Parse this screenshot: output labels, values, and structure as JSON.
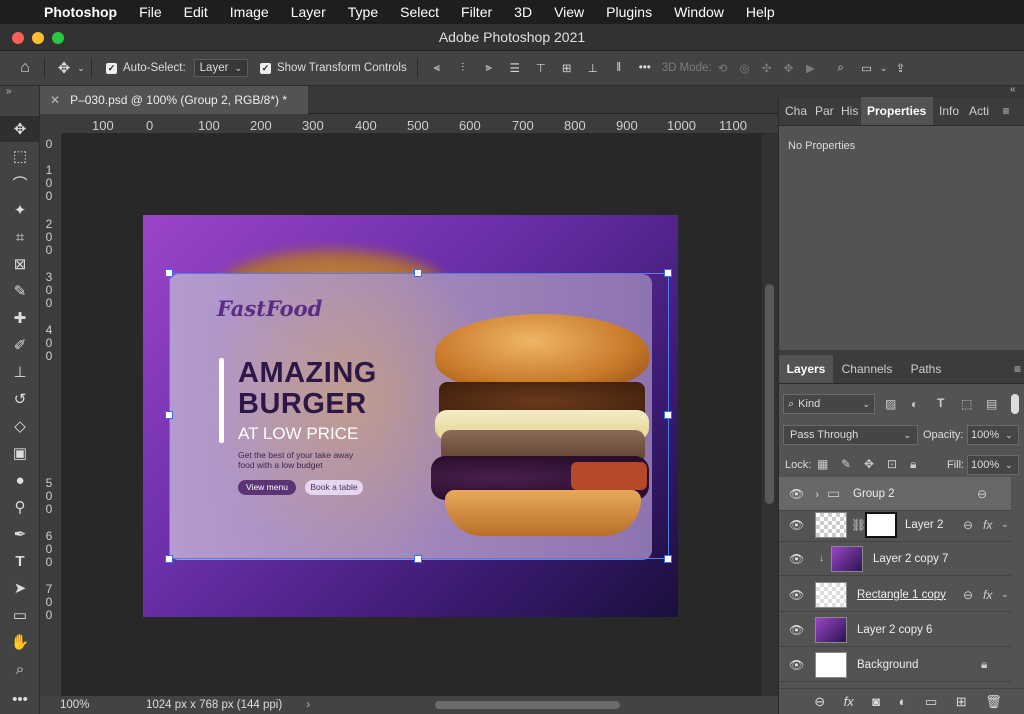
{
  "menubar": {
    "app": "Photoshop",
    "items": [
      "File",
      "Edit",
      "Image",
      "Layer",
      "Type",
      "Select",
      "Filter",
      "3D",
      "View",
      "Plugins",
      "Window",
      "Help"
    ]
  },
  "window": {
    "title": "Adobe Photoshop 2021"
  },
  "options_bar": {
    "auto_select_label": "Auto-Select:",
    "auto_select_value": "Layer",
    "show_transform_label": "Show Transform Controls",
    "more_label": "•••",
    "mode_3d_label": "3D Mode:"
  },
  "document": {
    "tab_title": "P–030.psd @ 100% (Group 2, RGB/8*) *",
    "zoom": "100%",
    "info": "1024 px x 768 px (144 ppi)"
  },
  "rulers": {
    "h": [
      "100",
      "0",
      "100",
      "200",
      "300",
      "400",
      "500",
      "600",
      "700",
      "800",
      "900",
      "1000",
      "1100"
    ],
    "v": [
      [
        "0"
      ],
      [
        "1",
        "0",
        "0"
      ],
      [
        "2",
        "0",
        "0"
      ],
      [
        "3",
        "0",
        "0"
      ],
      [
        "4",
        "0",
        "0"
      ],
      [
        "5",
        "0",
        "0"
      ],
      [
        "6",
        "0",
        "0"
      ],
      [
        "7",
        "0",
        "0"
      ]
    ]
  },
  "artwork": {
    "brand": "FastFood",
    "headline_line1": "AMAZING",
    "headline_line2": "BURGER",
    "subheadline": "AT LOW PRICE",
    "description": "Get the best of your take away food with a low budget",
    "button_primary": "View menu",
    "button_secondary": "Book a table",
    "colors": {
      "bg_start": "#9b45c8",
      "bg_end": "#1b0f3c",
      "accent": "#5b3478"
    }
  },
  "properties_panel": {
    "tabs": [
      "Cha",
      "Par",
      "His",
      "Properties",
      "Info",
      "Acti"
    ],
    "active_tab": "Properties",
    "content": "No Properties"
  },
  "layers_panel": {
    "tabs": [
      "Layers",
      "Channels",
      "Paths"
    ],
    "active_tab": "Layers",
    "filter_label": "Kind",
    "blend_mode": "Pass Through",
    "opacity_label": "Opacity:",
    "opacity": "100%",
    "lock_label": "Lock:",
    "fill_label": "Fill:",
    "fill": "100%",
    "layers": [
      {
        "name": "Group 2",
        "type": "group"
      },
      {
        "name": "Layer 2",
        "type": "masked"
      },
      {
        "name": "Layer 2 copy 7",
        "type": "clipped"
      },
      {
        "name": "Rectangle 1 copy",
        "type": "shape"
      },
      {
        "name": "Layer 2 copy 6",
        "type": "image"
      },
      {
        "name": "Background",
        "type": "background"
      }
    ]
  }
}
